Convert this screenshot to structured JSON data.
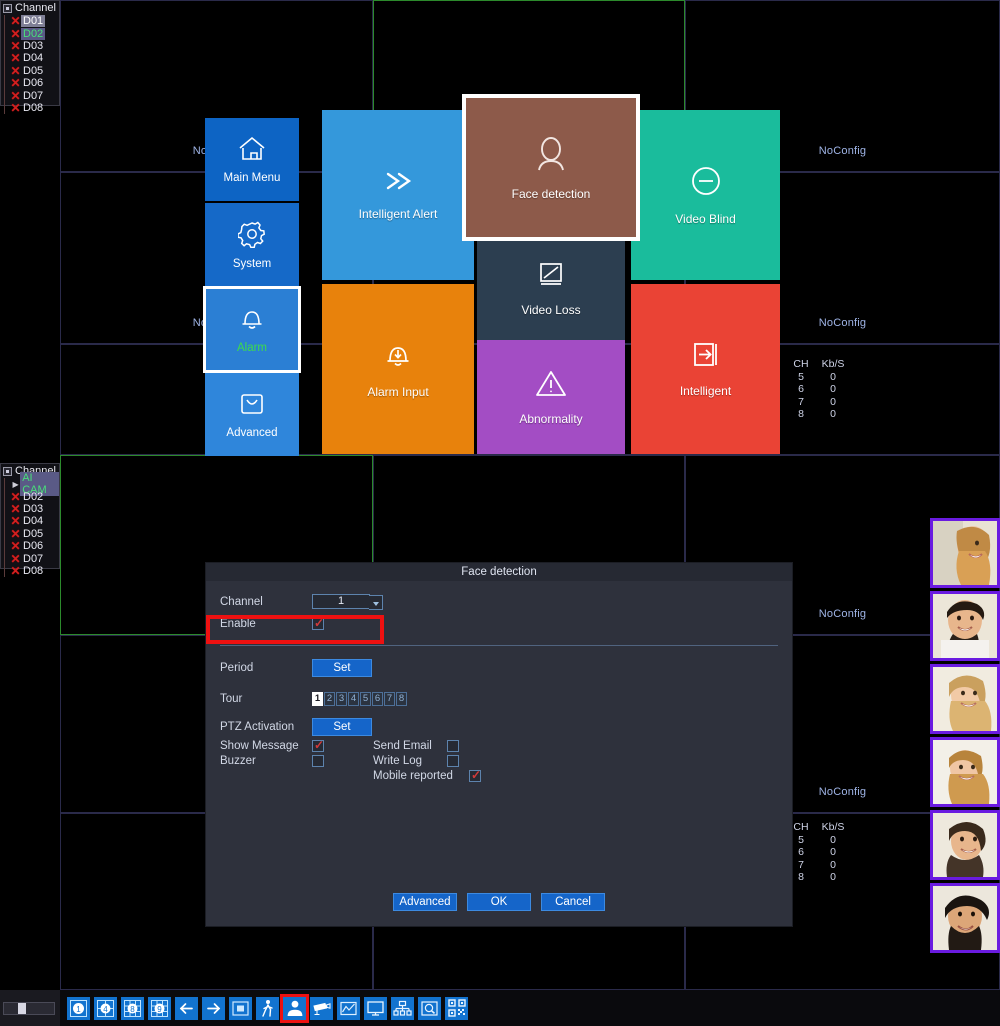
{
  "channel_panels": [
    {
      "header": "Channel",
      "items": [
        {
          "label": "D01",
          "state": "selected-white",
          "icon": "x-icon"
        },
        {
          "label": "D02",
          "state": "selected-green",
          "icon": "x-icon"
        },
        {
          "label": "D03",
          "state": "normal",
          "icon": "x-icon"
        },
        {
          "label": "D04",
          "state": "normal",
          "icon": "x-icon"
        },
        {
          "label": "D05",
          "state": "normal",
          "icon": "x-icon"
        },
        {
          "label": "D06",
          "state": "normal",
          "icon": "x-icon"
        },
        {
          "label": "D07",
          "state": "normal",
          "icon": "x-icon"
        },
        {
          "label": "D08",
          "state": "normal",
          "icon": "x-icon"
        }
      ]
    },
    {
      "header": "Channel",
      "items": [
        {
          "label": "AI CAM",
          "state": "selected-green",
          "icon": "play-triangle-icon"
        },
        {
          "label": "D02",
          "state": "normal",
          "icon": "x-icon"
        },
        {
          "label": "D03",
          "state": "normal",
          "icon": "x-icon"
        },
        {
          "label": "D04",
          "state": "normal",
          "icon": "x-icon"
        },
        {
          "label": "D05",
          "state": "normal",
          "icon": "x-icon"
        },
        {
          "label": "D06",
          "state": "normal",
          "icon": "x-icon"
        },
        {
          "label": "D07",
          "state": "normal",
          "icon": "x-icon"
        },
        {
          "label": "D08",
          "state": "normal",
          "icon": "x-icon"
        }
      ]
    }
  ],
  "video_wall": {
    "noconfig_label": "NoConfig",
    "cells": [
      {
        "noconfig": "NoConfig",
        "selected": false
      },
      {
        "noconfig": "NoConfig",
        "selected": true
      },
      {
        "noconfig": "NoConfig",
        "selected": false
      },
      {
        "noconfig": "NoConfig",
        "selected": false
      },
      {
        "noconfig": "NoConfig",
        "selected": false
      },
      {
        "noconfig": "NoConfig",
        "selected": false
      },
      {
        "noconfig": "NoConfig",
        "selected": false
      },
      {
        "noconfig": "NoConfig",
        "selected": false
      },
      {
        "noconfig": "NoConfig",
        "selected": false
      }
    ]
  },
  "bitrate_overlays": [
    {
      "header_ch": "CH",
      "header_rate": "Kb/S",
      "rows": [
        {
          "ch": "5",
          "rate": "0"
        },
        {
          "ch": "6",
          "rate": "0"
        },
        {
          "ch": "7",
          "rate": "0"
        },
        {
          "ch": "8",
          "rate": "0"
        }
      ]
    },
    {
      "header_ch": "CH",
      "header_rate": "Kb/S",
      "rows": [
        {
          "ch": "5",
          "rate": "0"
        },
        {
          "ch": "6",
          "rate": "0"
        },
        {
          "ch": "7",
          "rate": "0"
        },
        {
          "ch": "8",
          "rate": "0"
        }
      ]
    }
  ],
  "nav_menu": {
    "items": [
      {
        "label": "Main Menu",
        "icon": "home-icon",
        "color": "#0d64c4",
        "selected": false
      },
      {
        "label": "System",
        "icon": "gear-icon",
        "color": "#1569c8",
        "selected": false
      },
      {
        "label": "Alarm",
        "icon": "bell-icon",
        "color": "#2b7fd4",
        "selected": true
      },
      {
        "label": "Advanced",
        "icon": "bag-icon",
        "color": "#2f86db",
        "selected": false
      }
    ]
  },
  "tiles": [
    {
      "label": "Intelligent Alert",
      "icon": "double-chevron-right-icon",
      "color": "#3498db",
      "highlighted": false
    },
    {
      "label": "Face detection",
      "icon": "face-silhouette-icon",
      "color": "#8d5a4a",
      "highlighted": true
    },
    {
      "label": "Video Blind",
      "icon": "minus-circle-icon",
      "color": "#1abc9c",
      "highlighted": false
    },
    {
      "label": "Video Loss",
      "icon": "no-signal-screen-icon",
      "color": "#2c3e50",
      "highlighted": false
    },
    {
      "label": "Alarm Input",
      "icon": "bell-down-arrow-icon",
      "color": "#e8820c",
      "highlighted": false
    },
    {
      "label": "Abnormality",
      "icon": "warning-triangle-icon",
      "color": "#a34dc4",
      "highlighted": false
    },
    {
      "label": "Intelligent",
      "icon": "arrow-into-box-icon",
      "color": "#ea4335",
      "highlighted": false
    }
  ],
  "dialog": {
    "title": "Face detection",
    "fields": {
      "channel_label": "Channel",
      "channel_value": "1",
      "enable_label": "Enable",
      "enable_checked": true,
      "period_label": "Period",
      "period_button": "Set",
      "tour_label": "Tour",
      "tour_buttons": [
        "1",
        "2",
        "3",
        "4",
        "5",
        "6",
        "7",
        "8"
      ],
      "tour_selected": "1",
      "ptz_label": "PTZ Activation",
      "ptz_button": "Set",
      "show_message_label": "Show Message",
      "show_message_checked": true,
      "buzzer_label": "Buzzer",
      "buzzer_checked": false,
      "send_email_label": "Send Email",
      "send_email_checked": false,
      "write_log_label": "Write Log",
      "write_log_checked": false,
      "mobile_reported_label": "Mobile reported",
      "mobile_reported_checked": true
    },
    "buttons": {
      "advanced": "Advanced",
      "ok": "OK",
      "cancel": "Cancel"
    },
    "highlight_color": "#ee1111"
  },
  "thumbnails": [
    {
      "name": "face-thumbnail-1",
      "border": "#6a1be0"
    },
    {
      "name": "face-thumbnail-2",
      "border": "#6a1be0"
    },
    {
      "name": "face-thumbnail-3",
      "border": "#6a1be0"
    },
    {
      "name": "face-thumbnail-4",
      "border": "#6a1be0"
    },
    {
      "name": "face-thumbnail-5",
      "border": "#6a1be0"
    },
    {
      "name": "face-thumbnail-6",
      "border": "#6a1be0"
    }
  ],
  "toolbar": {
    "items": [
      {
        "name": "split-1-button",
        "icon": "split-1-icon",
        "label": "1",
        "highlighted": false
      },
      {
        "name": "split-4-button",
        "icon": "split-4-icon",
        "label": "4",
        "highlighted": false
      },
      {
        "name": "split-8-button",
        "icon": "split-8-icon",
        "label": "8",
        "highlighted": false
      },
      {
        "name": "split-9-button",
        "icon": "split-9-icon",
        "label": "9",
        "highlighted": false
      },
      {
        "name": "previous-button",
        "icon": "arrow-left-icon",
        "label": "",
        "highlighted": false
      },
      {
        "name": "next-button",
        "icon": "arrow-right-icon",
        "label": "",
        "highlighted": false
      },
      {
        "name": "pip-button",
        "icon": "pip-square-icon",
        "label": "",
        "highlighted": false
      },
      {
        "name": "human-detect-button",
        "icon": "walking-person-icon",
        "label": "",
        "highlighted": false
      },
      {
        "name": "face-detect-button",
        "icon": "person-bust-icon",
        "label": "",
        "highlighted": true
      },
      {
        "name": "camera-button",
        "icon": "cctv-camera-icon",
        "label": "",
        "highlighted": false
      },
      {
        "name": "chart-button",
        "icon": "line-chart-icon",
        "label": "",
        "highlighted": false
      },
      {
        "name": "display-button",
        "icon": "monitor-icon",
        "label": "",
        "highlighted": false
      },
      {
        "name": "network-button",
        "icon": "network-tree-icon",
        "label": "",
        "highlighted": false
      },
      {
        "name": "disk-search-button",
        "icon": "disk-search-icon",
        "label": "",
        "highlighted": false
      },
      {
        "name": "qrcode-button",
        "icon": "qr-code-icon",
        "label": "",
        "highlighted": false
      }
    ]
  }
}
